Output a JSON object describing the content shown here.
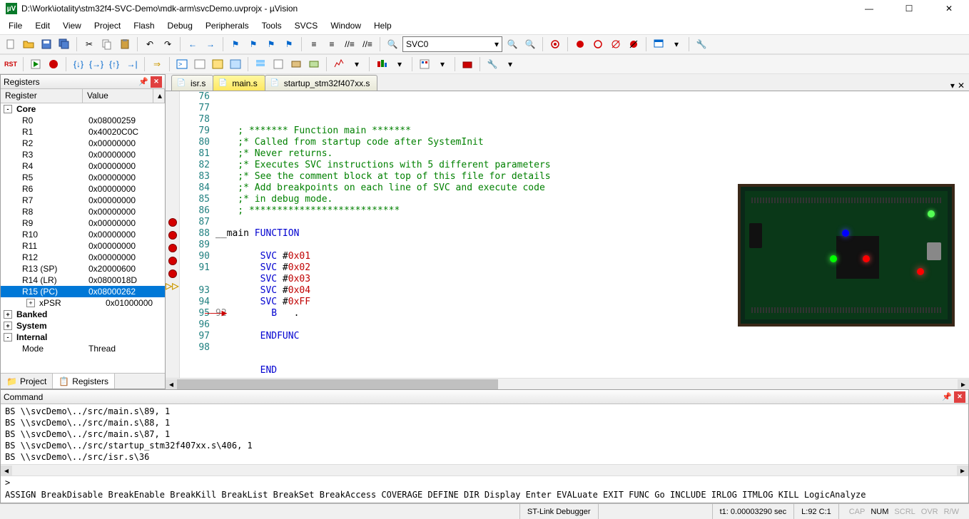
{
  "title": "D:\\Work\\iotality\\stm32f4-SVC-Demo\\mdk-arm\\svcDemo.uvprojx - µVision",
  "menu": [
    "File",
    "Edit",
    "View",
    "Project",
    "Flash",
    "Debug",
    "Peripherals",
    "Tools",
    "SVCS",
    "Window",
    "Help"
  ],
  "toolbar_combo": "SVC0",
  "registers_panel": {
    "title": "Registers",
    "columns": {
      "reg": "Register",
      "val": "Value"
    },
    "rows": [
      {
        "level": 0,
        "toggle": "-",
        "name": "Core",
        "val": ""
      },
      {
        "level": 1,
        "name": "R0",
        "val": "0x08000259"
      },
      {
        "level": 1,
        "name": "R1",
        "val": "0x40020C0C"
      },
      {
        "level": 1,
        "name": "R2",
        "val": "0x00000000"
      },
      {
        "level": 1,
        "name": "R3",
        "val": "0x00000000"
      },
      {
        "level": 1,
        "name": "R4",
        "val": "0x00000000"
      },
      {
        "level": 1,
        "name": "R5",
        "val": "0x00000000"
      },
      {
        "level": 1,
        "name": "R6",
        "val": "0x00000000"
      },
      {
        "level": 1,
        "name": "R7",
        "val": "0x00000000"
      },
      {
        "level": 1,
        "name": "R8",
        "val": "0x00000000"
      },
      {
        "level": 1,
        "name": "R9",
        "val": "0x00000000"
      },
      {
        "level": 1,
        "name": "R10",
        "val": "0x00000000"
      },
      {
        "level": 1,
        "name": "R11",
        "val": "0x00000000"
      },
      {
        "level": 1,
        "name": "R12",
        "val": "0x00000000"
      },
      {
        "level": 1,
        "name": "R13 (SP)",
        "val": "0x20000600"
      },
      {
        "level": 1,
        "name": "R14 (LR)",
        "val": "0x0800018D"
      },
      {
        "level": 1,
        "name": "R15 (PC)",
        "val": "0x08000262",
        "selected": true
      },
      {
        "level": 1,
        "toggle": "+",
        "name": "xPSR",
        "val": "0x01000000"
      },
      {
        "level": 0,
        "toggle": "+",
        "name": "Banked",
        "val": ""
      },
      {
        "level": 0,
        "toggle": "+",
        "name": "System",
        "val": ""
      },
      {
        "level": 0,
        "toggle": "-",
        "name": "Internal",
        "val": ""
      },
      {
        "level": 1,
        "name": "Mode",
        "val": "Thread"
      }
    ],
    "tabs": [
      {
        "icon": "proj",
        "label": "Project"
      },
      {
        "icon": "reg",
        "label": "Registers",
        "active": true
      }
    ]
  },
  "editor": {
    "tabs": [
      {
        "label": "isr.s",
        "active": false
      },
      {
        "label": "main.s",
        "active": true
      },
      {
        "label": "startup_stm32f407xx.s",
        "active": false
      }
    ],
    "lines": [
      {
        "n": 76,
        "raw": "    ; ******* Function main *******",
        "cls": "kw-green"
      },
      {
        "n": 77,
        "raw": "    ;* Called from startup code after SystemInit",
        "cls": "kw-green"
      },
      {
        "n": 78,
        "raw": "    ;* Never returns.",
        "cls": "kw-green"
      },
      {
        "n": 79,
        "raw": "    ;* Executes SVC instructions with 5 different parameters",
        "cls": "kw-green"
      },
      {
        "n": 80,
        "raw": "    ;* See the comment block at top of this file for details",
        "cls": "kw-green"
      },
      {
        "n": 81,
        "raw": "    ;* Add breakpoints on each line of SVC and execute code",
        "cls": "kw-green"
      },
      {
        "n": 82,
        "raw": "    ;* in debug mode.",
        "cls": "kw-green"
      },
      {
        "n": 83,
        "raw": "    ; ***************************",
        "cls": "kw-green"
      },
      {
        "n": 84,
        "raw": ""
      },
      {
        "n": 85,
        "raw": "__main ",
        "tail": "FUNCTION",
        "tailcls": "kw-blue"
      },
      {
        "n": 86,
        "raw": ""
      },
      {
        "n": 87,
        "bp": true,
        "raw": "        ",
        "mid": "SVC",
        "midcls": "kw-blue",
        "tail": " #",
        "num": "0x01"
      },
      {
        "n": 88,
        "bp": true,
        "raw": "        ",
        "mid": "SVC",
        "midcls": "kw-blue",
        "tail": " #",
        "num": "0x02"
      },
      {
        "n": 89,
        "bp": true,
        "raw": "        ",
        "mid": "SVC",
        "midcls": "kw-blue",
        "tail": " #",
        "num": "0x03"
      },
      {
        "n": 90,
        "bp": true,
        "raw": "        ",
        "mid": "SVC",
        "midcls": "kw-blue",
        "tail": " #",
        "num": "0x04"
      },
      {
        "n": 91,
        "bp": true,
        "raw": "        ",
        "mid": "SVC",
        "midcls": "kw-blue",
        "tail": " #",
        "num": "0xFF"
      },
      {
        "n": 92,
        "pc": true,
        "raw": "        ",
        "mid": "B",
        "midcls": "kw-blue",
        "tail": "   ."
      },
      {
        "n": 93,
        "raw": ""
      },
      {
        "n": 94,
        "raw": "        ",
        "mid": "ENDFUNC",
        "midcls": "kw-blue"
      },
      {
        "n": 95,
        "raw": ""
      },
      {
        "n": 96,
        "raw": ""
      },
      {
        "n": 97,
        "raw": "        ",
        "mid": "END",
        "midcls": "kw-blue"
      },
      {
        "n": 98,
        "raw": ""
      }
    ]
  },
  "command_panel": {
    "title": "Command",
    "lines": [
      "BS \\\\svcDemo\\../src/main.s\\89, 1",
      "BS \\\\svcDemo\\../src/main.s\\88, 1",
      "BS \\\\svcDemo\\../src/main.s\\87, 1",
      "BS \\\\svcDemo\\../src/startup_stm32f407xx.s\\406, 1",
      "BS \\\\svcDemo\\../src/isr.s\\36"
    ],
    "prompt": ">",
    "hint": "ASSIGN BreakDisable BreakEnable BreakKill BreakList BreakSet BreakAccess COVERAGE DEFINE DIR Display Enter EVALuate EXIT FUNC Go INCLUDE IRLOG ITMLOG KILL LogicAnalyze"
  },
  "status": {
    "debugger": "ST-Link Debugger",
    "time": "t1: 0.00003290 sec",
    "pos": "L:92 C:1",
    "indicators": [
      "CAP",
      "NUM",
      "SCRL",
      "OVR",
      "R/W"
    ]
  }
}
